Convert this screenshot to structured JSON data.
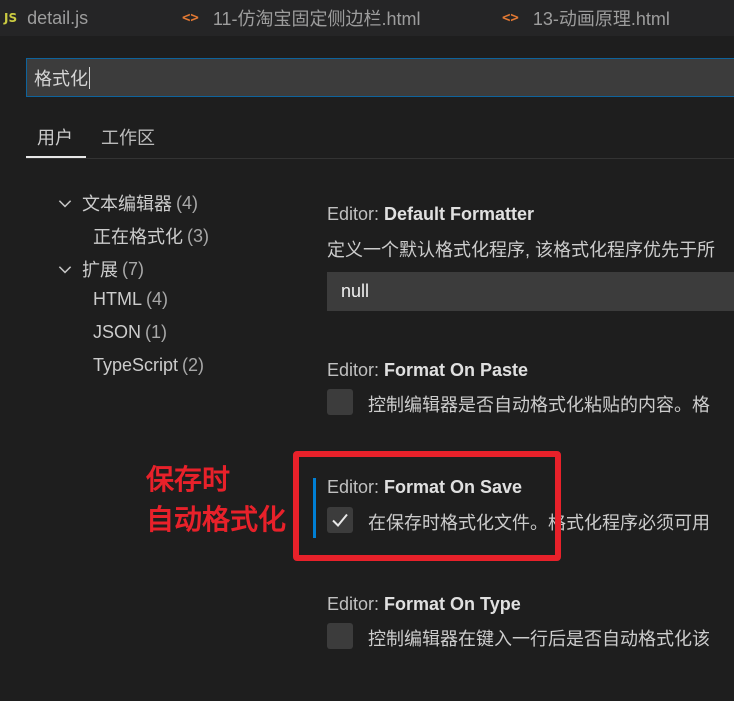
{
  "tabs": [
    {
      "label": "detail.js",
      "badge": "JS"
    },
    {
      "label": "11-仿淘宝固定侧边栏.html",
      "icon": "html-file-icon"
    },
    {
      "label": "13-动画原理.html",
      "icon": "html-file-icon"
    }
  ],
  "search": {
    "value": "格式化"
  },
  "scope_tabs": [
    {
      "label": "用户",
      "active": true
    },
    {
      "label": "工作区",
      "active": false
    }
  ],
  "tree": {
    "text_editor": {
      "label": "文本编辑器",
      "count": "(4)"
    },
    "formatting": {
      "label": "正在格式化",
      "count": "(3)"
    },
    "extensions": {
      "label": "扩展",
      "count": "(7)"
    },
    "html": {
      "label": "HTML",
      "count": "(4)"
    },
    "json": {
      "label": "JSON",
      "count": "(1)"
    },
    "typescript": {
      "label": "TypeScript",
      "count": "(2)"
    }
  },
  "settings": {
    "default_formatter": {
      "category": "Editor: ",
      "name": "Default Formatter",
      "description": "定义一个默认格式化程序, 该格式化程序优先于所",
      "value": "null"
    },
    "format_on_paste": {
      "category": "Editor: ",
      "name": "Format On Paste",
      "description": "控制编辑器是否自动格式化粘贴的内容。格",
      "checked": false
    },
    "format_on_save": {
      "category": "Editor: ",
      "name": "Format On Save",
      "description": "在保存时格式化文件。格式化程序必须可用",
      "checked": true
    },
    "format_on_type": {
      "category": "Editor: ",
      "name": "Format On Type",
      "description": "控制编辑器在键入一行后是否自动格式化该",
      "checked": false
    }
  },
  "annotation": {
    "line1": "保存时",
    "line2": "自动格式化",
    "color": "#e8212a"
  },
  "colors": {
    "background": "#1e1e1e",
    "tabbar": "#252526",
    "focus_border": "#007fd4",
    "input_bg": "#3c3c3c"
  }
}
